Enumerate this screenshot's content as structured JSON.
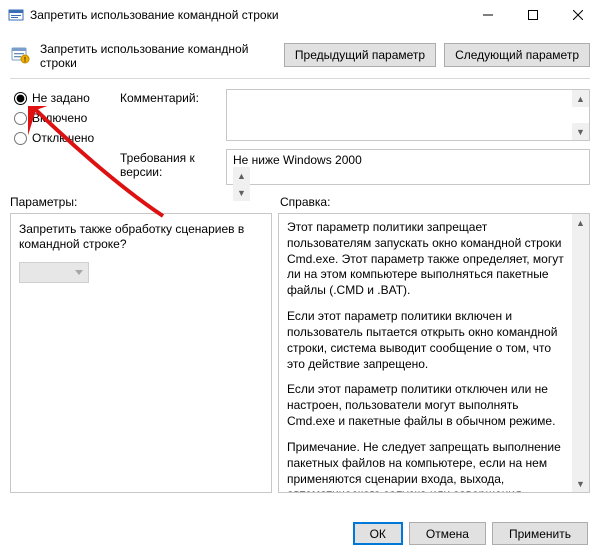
{
  "window": {
    "title": "Запретить использование командной строки"
  },
  "header": {
    "policy_title": "Запретить использование командной строки",
    "prev_btn": "Предыдущий параметр",
    "next_btn": "Следующий параметр"
  },
  "state": {
    "not_configured": "Не задано",
    "enabled": "Включено",
    "disabled": "Отключено",
    "selected": "not_configured"
  },
  "upper_labels": {
    "comment": "Комментарий:",
    "requirements": "Требования к версии:"
  },
  "requirements_value": "Не ниже Windows 2000",
  "mid": {
    "params": "Параметры:",
    "help": "Справка:"
  },
  "params_pane": {
    "question": "Запретить также обработку сценариев в командной строке?"
  },
  "help_paragraphs": [
    "Этот параметр политики запрещает пользователям запускать окно командной строки Cmd.exe. Этот параметр также определяет, могут ли на этом компьютере выполняться пакетные файлы (.CMD и .BAT).",
    "Если этот параметр политики включен и пользователь пытается открыть окно командной строки, система выводит сообщение о том, что это действие запрещено.",
    "Если этот параметр политики отключен или не настроен, пользователи могут выполнять Cmd.exe и пакетные файлы в обычном режиме.",
    "Примечание. Не следует запрещать выполнение пакетных файлов на компьютере, если на нем применяются сценарии входа, выхода, автоматического запуска или завершения работы, а также пользователям, использующим службы удаленных рабочих столов."
  ],
  "footer": {
    "ok": "ОК",
    "cancel": "Отмена",
    "apply": "Применить"
  }
}
